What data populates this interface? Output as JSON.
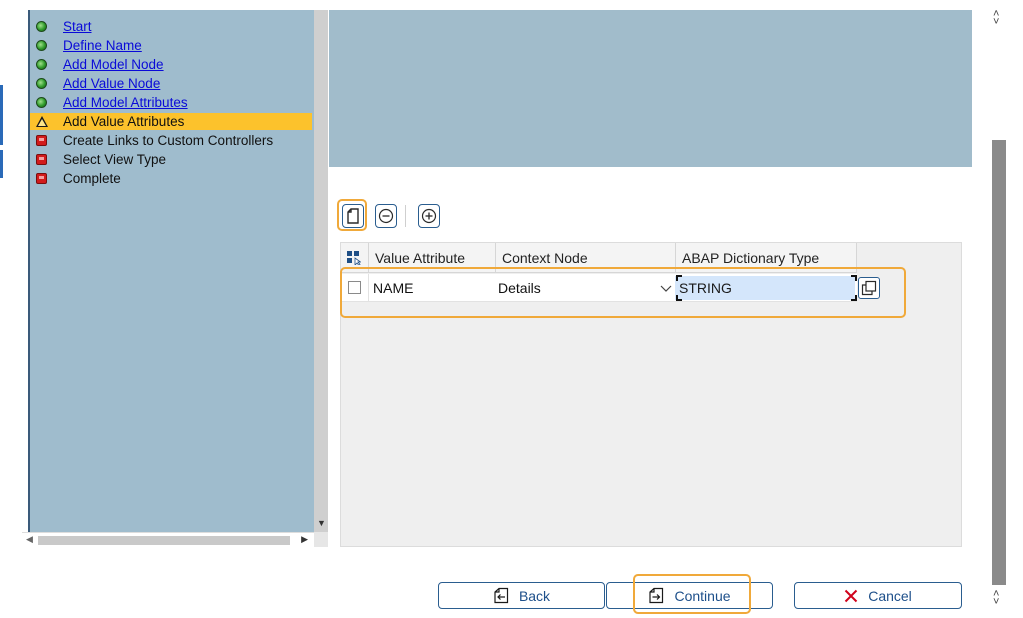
{
  "wizard_steps": [
    {
      "label": "Start",
      "status": "done"
    },
    {
      "label": "Define Name",
      "status": "done"
    },
    {
      "label": "Add Model Node",
      "status": "done"
    },
    {
      "label": "Add Value Node",
      "status": "done"
    },
    {
      "label": "Add Model Attributes",
      "status": "done"
    },
    {
      "label": "Add Value Attributes",
      "status": "current"
    },
    {
      "label": "Create Links to Custom Controllers",
      "status": "pending"
    },
    {
      "label": "Select View Type",
      "status": "pending"
    },
    {
      "label": "Complete",
      "status": "pending"
    }
  ],
  "toolbar": {
    "new_icon": "new-document-icon",
    "remove_icon": "minus-circle-icon",
    "add_icon": "plus-circle-icon"
  },
  "table": {
    "columns": [
      "Value Attribute",
      "Context Node",
      "ABAP Dictionary Type"
    ],
    "rows": [
      {
        "value_attribute": "NAME",
        "context_node": "Details",
        "abap_type": "STRING"
      }
    ]
  },
  "footer": {
    "back_label": "Back",
    "continue_label": "Continue",
    "cancel_label": "Cancel"
  },
  "colors": {
    "panel_bg": "#9fbccd",
    "active_step": "#fcc22c",
    "link": "#0a0ad8",
    "highlight": "#f0a93a",
    "button_text": "#1d4f8a",
    "cancel_x": "#d0021b"
  }
}
